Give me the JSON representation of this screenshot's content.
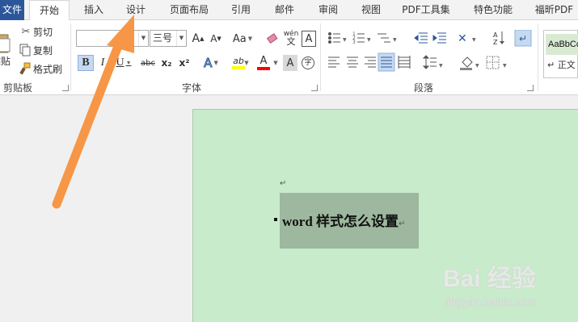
{
  "tabs": {
    "file": "文件",
    "home": "开始",
    "insert": "插入",
    "design": "设计",
    "layout": "页面布局",
    "references": "引用",
    "mailings": "邮件",
    "review": "审阅",
    "view": "视图",
    "pdf_tools": "PDF工具集",
    "special": "特色功能",
    "foxit": "福昕PDF"
  },
  "clipboard": {
    "paste": "粘贴",
    "cut": "剪切",
    "copy": "复制",
    "format_painter": "格式刷",
    "group_label": "剪贴板"
  },
  "font": {
    "font_name": "",
    "font_size": "三号",
    "grow": "A",
    "shrink": "A",
    "change_case": "Aa",
    "phonetic": "wén",
    "char_border": "A",
    "bold": "B",
    "italic": "I",
    "underline": "U",
    "strikethrough": "abc",
    "subscript": "x₂",
    "superscript": "x²",
    "text_effects": "A",
    "highlight": "ab",
    "font_color": "A",
    "char_shading": "A",
    "enclose": "字",
    "group_label": "字体"
  },
  "paragraph": {
    "group_label": "段落"
  },
  "styles": {
    "sample": "AaBbCcDd",
    "sub": "↵ 正文"
  },
  "document": {
    "para_mark": "↵",
    "text": "word 样式怎么设置",
    "end_mark": "↵"
  },
  "watermark": {
    "logo": "Bai 经验",
    "url": "jingyan.baidu.com"
  },
  "colors": {
    "file_tab": "#2b579a",
    "page_bg": "#c8ebcb",
    "selection": "#9db89f",
    "arrow": "#f79646",
    "highlight_bar": "#ffff00",
    "font_color_bar": "#ff0000"
  }
}
